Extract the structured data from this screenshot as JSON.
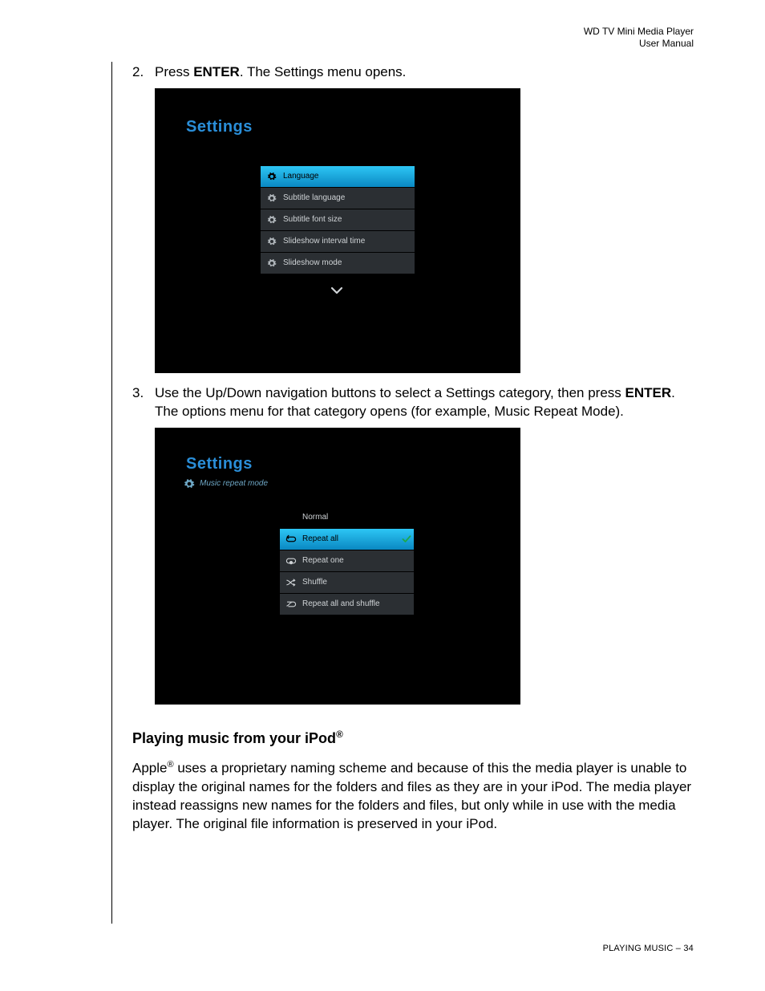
{
  "header": {
    "line1": "WD TV Mini Media Player",
    "line2": "User Manual"
  },
  "steps": {
    "s2": {
      "num": "2.",
      "pre": "Press ",
      "bold": "ENTER",
      "post": ". The Settings menu opens."
    },
    "s3": {
      "num": "3.",
      "pre": "Use the Up/Down navigation buttons to select a Settings category, then press ",
      "bold": "ENTER",
      "post": ". The options menu for that category opens (for example, Music Repeat Mode)."
    }
  },
  "ss1": {
    "title": "Settings",
    "items": {
      "i0": "Language",
      "i1": "Subtitle language",
      "i2": "Subtitle font size",
      "i3": "Slideshow interval time",
      "i4": "Slideshow mode"
    }
  },
  "ss2": {
    "title": "Settings",
    "subtitle": "Music repeat mode",
    "items": {
      "i0": "Normal",
      "i1": "Repeat all",
      "i2": "Repeat one",
      "i3": "Shuffle",
      "i4": "Repeat all and shuffle"
    }
  },
  "section": {
    "heading_pre": "Playing music from your iPod",
    "reg": "®",
    "para_pre": "Apple",
    "para_post": " uses a proprietary naming scheme and because of this the media player is unable to display the original names for the folders and files as they are in your iPod. The media player instead reassigns new names for the folders and files, but only while in use with the media player. The original file information is preserved in your iPod."
  },
  "footer": "PLAYING MUSIC – 34"
}
